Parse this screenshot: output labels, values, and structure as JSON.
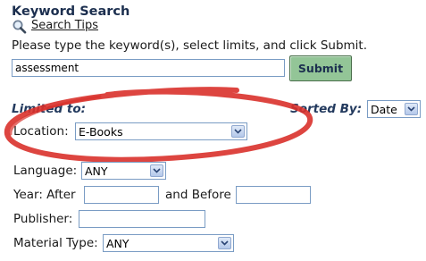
{
  "header": {
    "title": "Keyword Search",
    "search_tips_label": "Search Tips",
    "instructions": "Please type the keyword(s), select limits, and click Submit."
  },
  "search": {
    "keyword_value": "assessment",
    "submit_label": "Submit"
  },
  "limits": {
    "limited_to_label": "Limited to:",
    "sorted_by_label": "Sorted By:",
    "sorted_by_value": "Date",
    "location_label": "Location:",
    "location_value": "E-Books",
    "language_label": "Language:",
    "language_value": "ANY",
    "year_label": "Year: After",
    "year_after_value": "",
    "and_before_label": "and Before",
    "year_before_value": "",
    "publisher_label": "Publisher:",
    "publisher_value": "",
    "material_type_label": "Material Type:",
    "material_type_value": "ANY"
  },
  "colors": {
    "highlight_ring": "#d9312b",
    "submit_bg": "#93c597",
    "title_text": "#1c2f4f"
  },
  "icons": {
    "search_tips": "magnifier-icon",
    "dropdown": "chevron-down-icon"
  }
}
